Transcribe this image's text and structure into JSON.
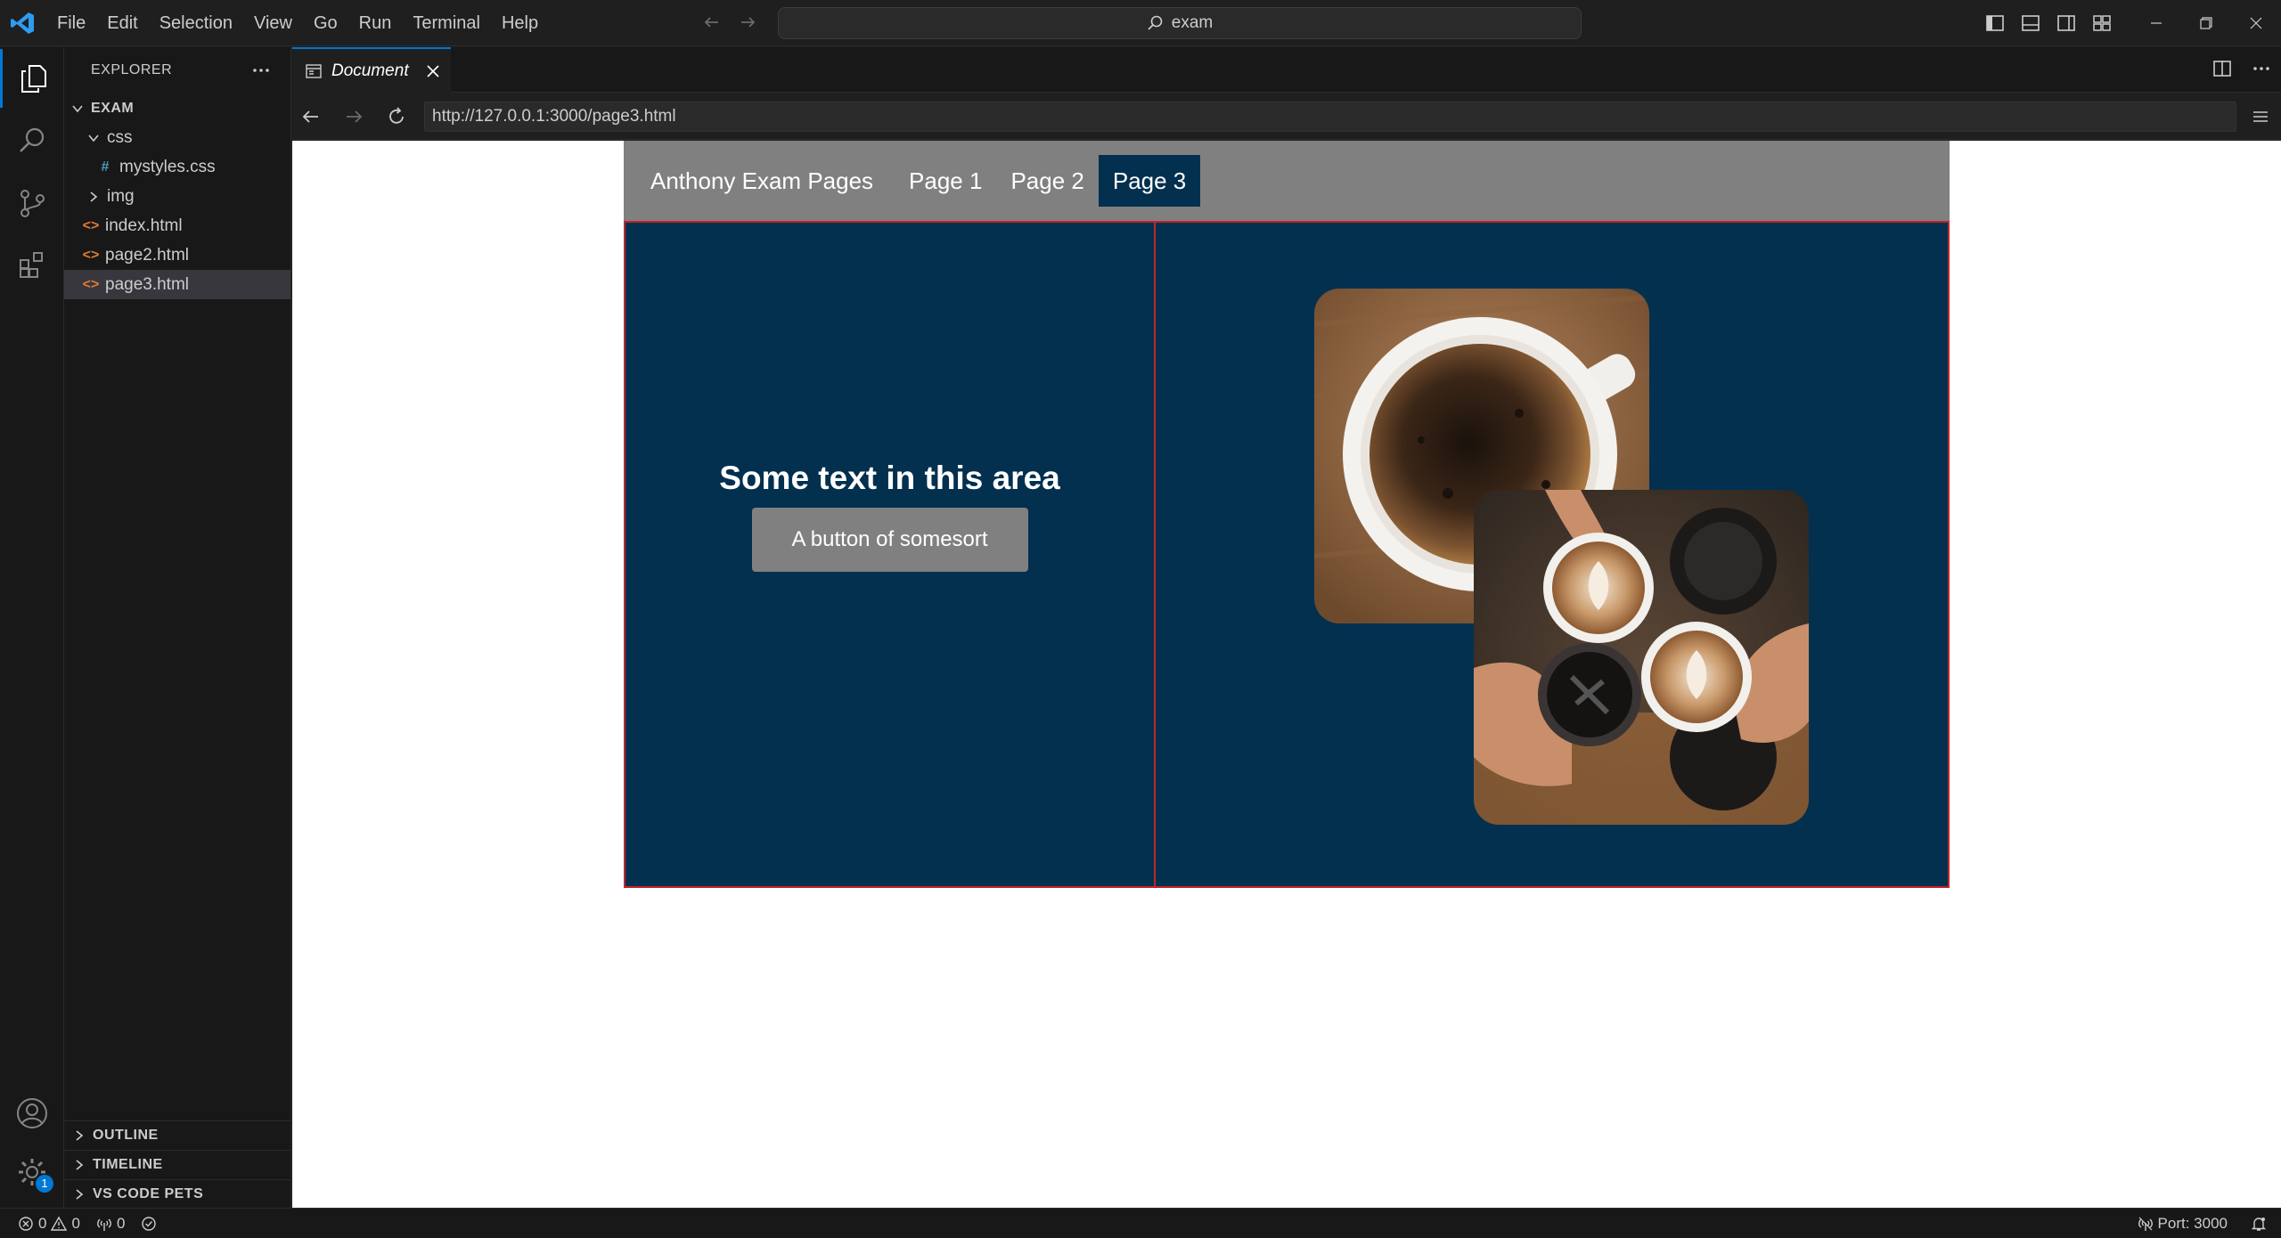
{
  "titlebar": {
    "menu": [
      "File",
      "Edit",
      "Selection",
      "View",
      "Go",
      "Run",
      "Terminal",
      "Help"
    ],
    "search_text": "exam"
  },
  "explorer": {
    "header": "EXPLORER",
    "folder": "EXAM",
    "items": [
      {
        "label": "css",
        "type": "folder-open"
      },
      {
        "label": "mystyles.css",
        "type": "css"
      },
      {
        "label": "img",
        "type": "folder-closed"
      },
      {
        "label": "index.html",
        "type": "html"
      },
      {
        "label": "page2.html",
        "type": "html"
      },
      {
        "label": "page3.html",
        "type": "html",
        "selected": true
      }
    ],
    "sections": [
      "OUTLINE",
      "TIMELINE",
      "VS CODE PETS"
    ]
  },
  "editor": {
    "tab_label": "Document",
    "url": "http://127.0.0.1:3000/page3.html"
  },
  "site": {
    "brand": "Anthony Exam Pages",
    "links": [
      "Page 1",
      "Page 2",
      "Page 3"
    ],
    "active_link": "Page 3",
    "hero_text": "Some text in this area",
    "button_label": "A button of somesort",
    "images": [
      "coffee cup top view",
      "hands holding coffee cups"
    ]
  },
  "statusbar": {
    "errors": "0",
    "warnings": "0",
    "ports": "0",
    "port_label": "Port: 3000"
  },
  "activity": {
    "settings_badge": "1"
  },
  "colors": {
    "accent": "#0078d4",
    "site_bg": "#03304f",
    "nav_bg": "#808080",
    "border_red": "#c2242b"
  }
}
